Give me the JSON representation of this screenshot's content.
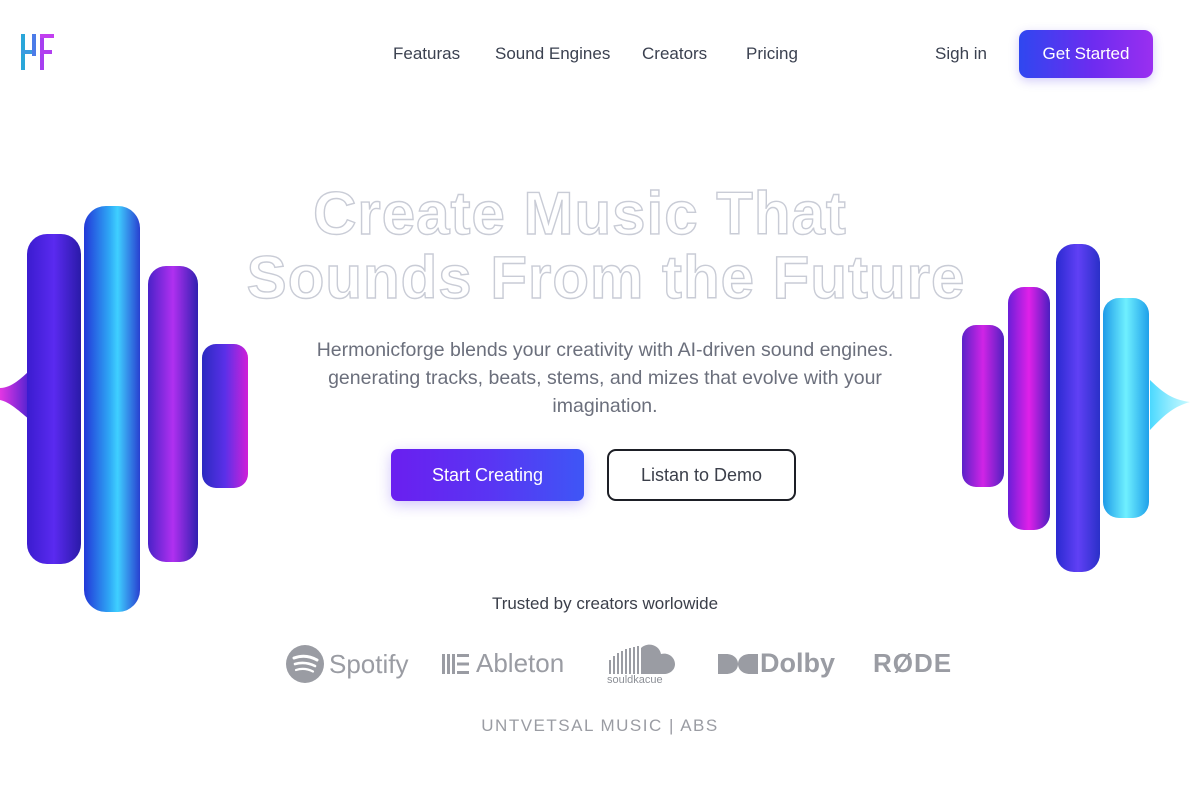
{
  "nav": {
    "links": [
      "Featuras",
      "Sound Engines",
      "Creators",
      "Pricing"
    ],
    "signin": "Sigh in",
    "cta": "Get Started"
  },
  "hero": {
    "title_line1": "Create Music That",
    "title_line2": "Sounds From the Future",
    "subtitle_line1": "Hermonicforge blends your creativity with AI-driven sound engines.",
    "subtitle_line2": "generating tracks, beats, stems, and mizes that evolve with your",
    "subtitle_line3": "imagination.",
    "primary_cta": "Start Creating",
    "secondary_cta": "Listan to Demo"
  },
  "trusted": {
    "label": "Trusted by creators worlowide",
    "brands": {
      "spotify": "Spotify",
      "ableton": "Ableton",
      "soundcloud": "souldkacue",
      "dolby": "Dolby",
      "rode": "RØDE",
      "universal": "UNTVETSAL MUSIC | ABS"
    }
  },
  "colors": {
    "accent_purple": "#6a1ff0",
    "accent_blue": "#2f47f0",
    "accent_magenta": "#d21fe0",
    "accent_cyan": "#22c9f0"
  }
}
